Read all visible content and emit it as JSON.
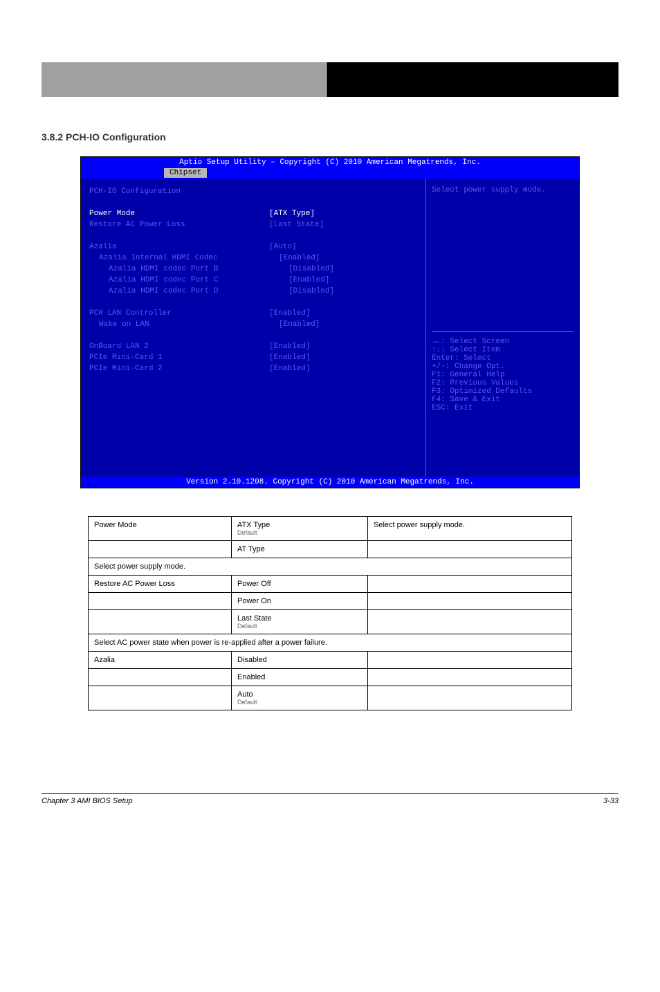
{
  "header": {
    "right": ""
  },
  "section_title": "3.8.2  PCH-IO Configuration",
  "bios": {
    "top": "Aptio Setup Utility – Copyright (C) 2010 American Megatrends, Inc.",
    "tab": "Chipset",
    "title": "PCH-IO Configuration",
    "rows": [
      {
        "l": "Power Mode",
        "v": "[ATX Type]",
        "cls": "wht"
      },
      {
        "l": "Restore AC Power Loss",
        "v": "[Last State]",
        "cls": "cya"
      },
      {
        "sp": 1
      },
      {
        "l": "Azalia",
        "v": "[Auto]",
        "cls": "cya"
      },
      {
        "l": "Azalia Internal HDMI Codec",
        "v": "[Enabled]",
        "cls": "cya",
        "ind": 1
      },
      {
        "l": "Azalia HDMI codec Port B",
        "v": "[Disabled]",
        "cls": "cya",
        "ind": 2
      },
      {
        "l": "Azalia HDMI codec Port C",
        "v": "[Enabled]",
        "cls": "cya",
        "ind": 2
      },
      {
        "l": "Azalia HDMI codec Port D",
        "v": "[Disabled]",
        "cls": "cya",
        "ind": 2
      },
      {
        "sp": 1
      },
      {
        "l": "PCH LAN Controller",
        "v": "[Enabled]",
        "cls": "cya"
      },
      {
        "l": "Wake on LAN",
        "v": "[Enabled]",
        "cls": "cya",
        "ind": 1
      },
      {
        "sp": 1
      },
      {
        "l": "OnBoard LAN 2",
        "v": "[Enabled]",
        "cls": "cya"
      },
      {
        "l": "PCIe Mini-Card 1",
        "v": "[Enabled]",
        "cls": "cya"
      },
      {
        "l": "PCIe Mini-Card 2",
        "v": "[Enabled]",
        "cls": "cya"
      }
    ],
    "help_top": "Select power supply mode.",
    "help": [
      "→←: Select Screen",
      "↑↓: Select Item",
      "Enter: Select",
      "+/-: Change Opt.",
      "F1: General Help",
      "F2: Previous Values",
      "F3: Optimized Defaults",
      "F4: Save & Exit",
      "ESC: Exit"
    ],
    "foot": "Version 2.10.1208. Copyright (C) 2010 American Megatrends, Inc."
  },
  "table": [
    [
      "Power Mode",
      "ATX Type\nDefault",
      "Select power supply mode."
    ],
    [
      "",
      "AT Type",
      ""
    ],
    [
      "Select power supply mode."
    ],
    [
      "Restore AC Power Loss",
      "Power Off",
      ""
    ],
    [
      "",
      "Power On",
      ""
    ],
    [
      "",
      "Last State\nDefault",
      ""
    ],
    [
      "Select AC power state when power is re-applied after a power failure."
    ],
    [
      "Azalia",
      "Disabled",
      ""
    ],
    [
      "",
      "Enabled",
      ""
    ],
    [
      "",
      "Auto\nDefault",
      ""
    ]
  ],
  "footer": {
    "left": "Chapter 3 AMI BIOS Setup",
    "right": "3-33"
  }
}
